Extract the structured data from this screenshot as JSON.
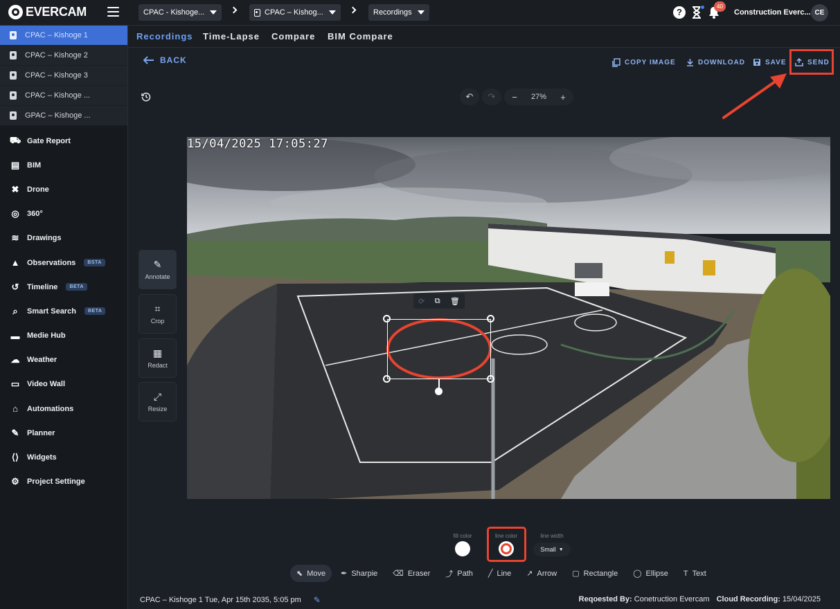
{
  "app": {
    "logo_text": "EVERCAM"
  },
  "breadcrumbs": [
    {
      "label": "CPAC - Kishoge..."
    },
    {
      "label": "CPAC – Kishog..."
    },
    {
      "label": "Recordings"
    }
  ],
  "header": {
    "notification_count": "40",
    "user_name": "Construction Everc...",
    "avatar_initials": "CE"
  },
  "sidebar": {
    "cameras": [
      {
        "label": "CPAC – Kishoge 1"
      },
      {
        "label": "CPAC – Kishoge 2"
      },
      {
        "label": "CPAC – Kishoge 3"
      },
      {
        "label": "CPAC – Kishoge ..."
      },
      {
        "label": "GPAC – Kishoge ..."
      }
    ],
    "nav": [
      {
        "label": "Gate Report",
        "icon": "truck-icon"
      },
      {
        "label": "BIM",
        "icon": "building-icon"
      },
      {
        "label": "Drone",
        "icon": "drone-icon"
      },
      {
        "label": "360°",
        "icon": "panorama-icon"
      },
      {
        "label": "Drawings",
        "icon": "layers-icon"
      },
      {
        "label": "Observations",
        "icon": "observations-icon",
        "badge": "BSTA"
      },
      {
        "label": "Timeline",
        "icon": "history-icon",
        "badge": "BETA"
      },
      {
        "label": "Smart Search",
        "icon": "search-icon",
        "badge": "BETA"
      },
      {
        "label": "Medie Hub",
        "icon": "media-icon"
      },
      {
        "label": "Weather",
        "icon": "weather-icon"
      },
      {
        "label": "Video Wall",
        "icon": "monitor-icon"
      },
      {
        "label": "Automations",
        "icon": "automation-icon"
      },
      {
        "label": "Planner",
        "icon": "edit-icon"
      },
      {
        "label": "Widgets",
        "icon": "code-icon"
      },
      {
        "label": "Project Settinge",
        "icon": "gear-icon"
      }
    ]
  },
  "tabs": [
    {
      "label": "Recordings"
    },
    {
      "label": "Time-Lapse"
    },
    {
      "label": "Compare"
    },
    {
      "label": "BIM Compare"
    }
  ],
  "actions": {
    "back": "BACK",
    "copy_image": "COPY IMAGE",
    "download": "DOWNLOAD",
    "save": "SAVE",
    "send": "SEND"
  },
  "zoom": {
    "minus": "−",
    "value": "27%",
    "plus": "+"
  },
  "tool_panel": [
    {
      "label": "Annotate",
      "glyph": "✎"
    },
    {
      "label": "Crop",
      "glyph": "⌗"
    },
    {
      "label": "Redact",
      "glyph": "▦"
    },
    {
      "label": "Resize",
      "glyph": "⤢"
    }
  ],
  "image": {
    "timestamp": "15/04/2025 17:05:27"
  },
  "style_controls": {
    "fill_color_label": "fill color",
    "line_color_label": "line color",
    "line_width_label": "line width",
    "line_width_value": "Small",
    "fill_color": "#ffffff",
    "line_color": "#e8442f"
  },
  "draw_tools": [
    {
      "label": "Move",
      "glyph": "⬉"
    },
    {
      "label": "Sharpie",
      "glyph": "✒"
    },
    {
      "label": "Eraser",
      "glyph": "⌫"
    },
    {
      "label": "Path",
      "glyph": "⤴"
    },
    {
      "label": "Line",
      "glyph": "╱"
    },
    {
      "label": "Arrow",
      "glyph": "↗"
    },
    {
      "label": "Rectangle",
      "glyph": "▢"
    },
    {
      "label": "Ellipse",
      "glyph": "◯"
    },
    {
      "label": "Text",
      "glyph": "T"
    }
  ],
  "footer": {
    "caption": "CPAC – Kishoge 1 Tue, Apr 15th 2035, 5:05 pm",
    "requested_by_label": "Reqoested By:",
    "requested_by_value": "Conetruction Evercam",
    "cloud_label": "Cloud Recording:",
    "cloud_value": "15/04/2025"
  },
  "colors": {
    "accent": "#6ea2f5",
    "highlight": "#e8442f",
    "active_camera": "#3d6fd6"
  }
}
